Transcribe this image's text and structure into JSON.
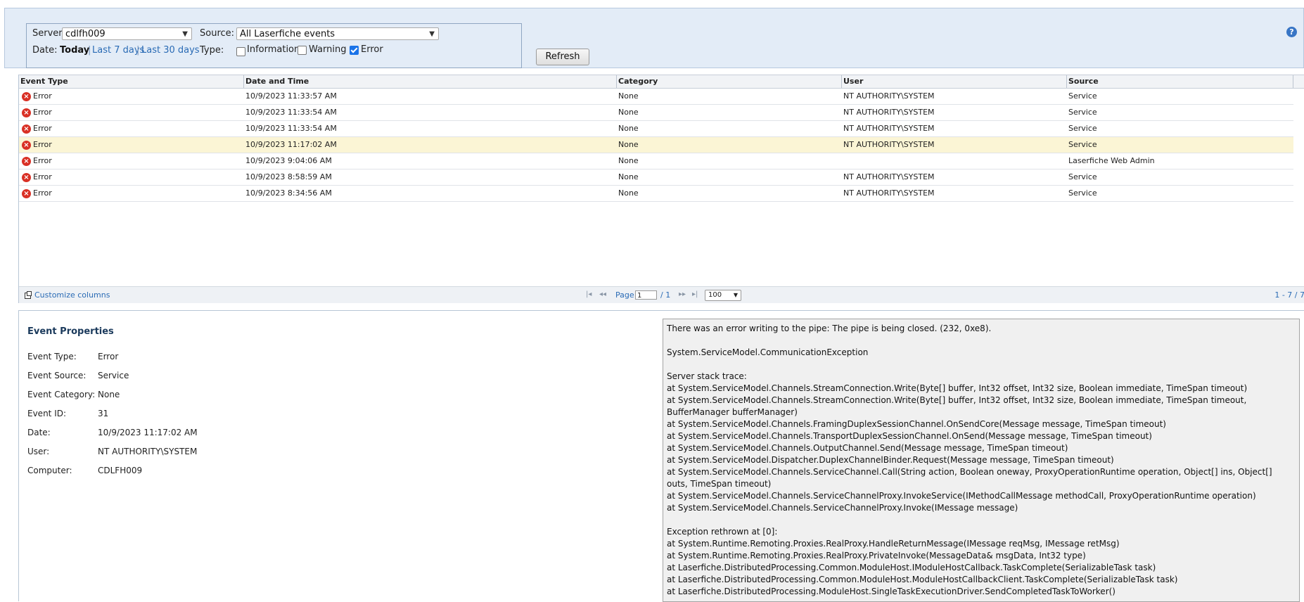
{
  "filters": {
    "server_label": "Server:",
    "server_value": "cdlfh009",
    "source_label": "Source:",
    "source_value": "All Laserfiche events",
    "date_label": "Date:",
    "date_today": "Today",
    "date_last7": "Last 7 days",
    "date_last30": "Last 30 days",
    "separator": "|",
    "type_label": "Type:",
    "type_information": "Information",
    "type_warning": "Warning",
    "type_error": "Error",
    "information_checked": false,
    "warning_checked": false,
    "error_checked": true,
    "refresh_label": "Refresh"
  },
  "help_icon": "?",
  "grid": {
    "columns": [
      "Event Type",
      "Date and Time",
      "Category",
      "User",
      "Source"
    ],
    "rows": [
      {
        "type": "Error",
        "datetime": "10/9/2023 11:33:57 AM",
        "category": "None",
        "user": "NT AUTHORITY\\SYSTEM",
        "source": "Service"
      },
      {
        "type": "Error",
        "datetime": "10/9/2023 11:33:54 AM",
        "category": "None",
        "user": "NT AUTHORITY\\SYSTEM",
        "source": "Service"
      },
      {
        "type": "Error",
        "datetime": "10/9/2023 11:33:54 AM",
        "category": "None",
        "user": "NT AUTHORITY\\SYSTEM",
        "source": "Service"
      },
      {
        "type": "Error",
        "datetime": "10/9/2023 11:17:02 AM",
        "category": "None",
        "user": "NT AUTHORITY\\SYSTEM",
        "source": "Service"
      },
      {
        "type": "Error",
        "datetime": "10/9/2023 9:04:06 AM",
        "category": "None",
        "user": "",
        "source": "Laserfiche Web Admin"
      },
      {
        "type": "Error",
        "datetime": "10/9/2023 8:58:59 AM",
        "category": "None",
        "user": "NT AUTHORITY\\SYSTEM",
        "source": "Service"
      },
      {
        "type": "Error",
        "datetime": "10/9/2023 8:34:56 AM",
        "category": "None",
        "user": "NT AUTHORITY\\SYSTEM",
        "source": "Service"
      }
    ],
    "selected_row": 3,
    "error_glyph": "×",
    "footer": {
      "customize_label": "Customize columns",
      "nav_first": "|◂",
      "nav_prev": "◂◂",
      "page_label": "Page",
      "page_value": "1",
      "page_total": "/ 1",
      "nav_next": "▸▸",
      "nav_last": "▸|",
      "page_size": "100",
      "count": "1 - 7 / 7"
    }
  },
  "properties": {
    "title": "Event Properties",
    "fields": [
      {
        "label": "Event Type:",
        "value": "Error"
      },
      {
        "label": "Event Source:",
        "value": "Service"
      },
      {
        "label": "Event Category:",
        "value": "None"
      },
      {
        "label": "Event ID:",
        "value": "31"
      },
      {
        "label": "Date:",
        "value": "10/9/2023 11:17:02 AM"
      },
      {
        "label": "User:",
        "value": "NT AUTHORITY\\SYSTEM"
      },
      {
        "label": "Computer:",
        "value": "CDLFH009"
      }
    ]
  },
  "message": [
    "There was an error writing to the pipe: The pipe is being closed. (232, 0xe8).",
    "",
    "System.ServiceModel.CommunicationException",
    "",
    "Server stack trace:",
    "at System.ServiceModel.Channels.StreamConnection.Write(Byte[] buffer, Int32 offset, Int32 size, Boolean immediate, TimeSpan timeout)",
    "at System.ServiceModel.Channels.StreamConnection.Write(Byte[] buffer, Int32 offset, Int32 size, Boolean immediate, TimeSpan timeout,",
    "BufferManager bufferManager)",
    "at System.ServiceModel.Channels.FramingDuplexSessionChannel.OnSendCore(Message message, TimeSpan timeout)",
    "at System.ServiceModel.Channels.TransportDuplexSessionChannel.OnSend(Message message, TimeSpan timeout)",
    "at System.ServiceModel.Channels.OutputChannel.Send(Message message, TimeSpan timeout)",
    "at System.ServiceModel.Dispatcher.DuplexChannelBinder.Request(Message message, TimeSpan timeout)",
    "at System.ServiceModel.Channels.ServiceChannel.Call(String action, Boolean oneway, ProxyOperationRuntime operation, Object[] ins, Object[]",
    "outs, TimeSpan timeout)",
    "at System.ServiceModel.Channels.ServiceChannelProxy.InvokeService(IMethodCallMessage methodCall, ProxyOperationRuntime operation)",
    "at System.ServiceModel.Channels.ServiceChannelProxy.Invoke(IMessage message)",
    "",
    "Exception rethrown at [0]:",
    "at System.Runtime.Remoting.Proxies.RealProxy.HandleReturnMessage(IMessage reqMsg, IMessage retMsg)",
    "at System.Runtime.Remoting.Proxies.RealProxy.PrivateInvoke(MessageData& msgData, Int32 type)",
    "at Laserfiche.DistributedProcessing.Common.ModuleHost.IModuleHostCallback.TaskComplete(SerializableTask task)",
    "at Laserfiche.DistributedProcessing.Common.ModuleHost.ModuleHostCallbackClient.TaskComplete(SerializableTask task)",
    "at Laserfiche.DistributedProcessing.ModuleHost.SingleTaskExecutionDriver.SendCompletedTaskToWorker()"
  ],
  "colors": {
    "error_red": "#d93025",
    "link_blue": "#2a6bb5",
    "selected_row": "#fbf5d5",
    "panel_blue": "#e3ecf7"
  }
}
